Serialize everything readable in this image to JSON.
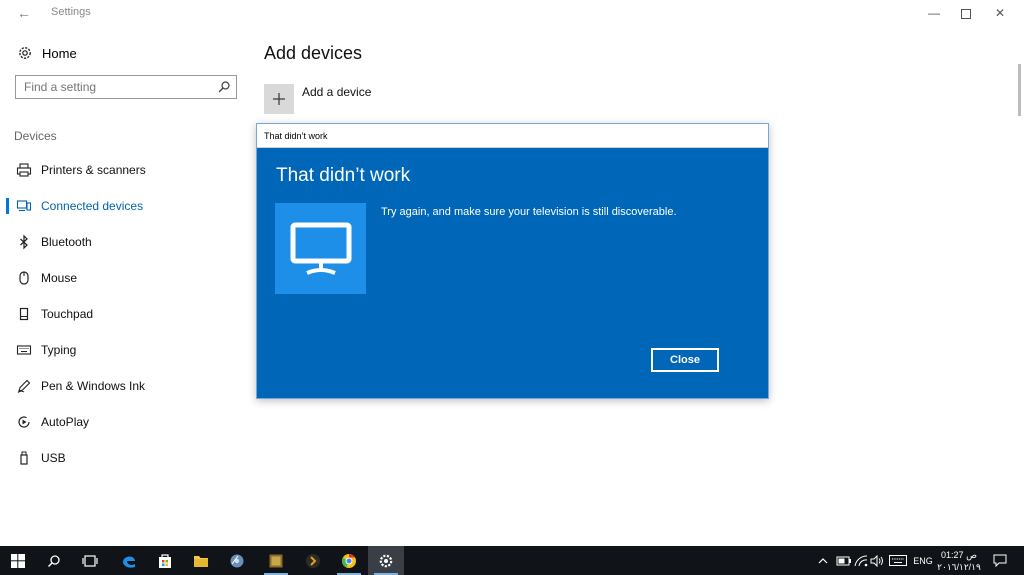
{
  "window": {
    "title": "Settings",
    "back_glyph": "←",
    "minimize_glyph": "—",
    "close_glyph": "✕"
  },
  "sidebar": {
    "home_label": "Home",
    "search_placeholder": "Find a setting",
    "section_label": "Devices",
    "items": [
      {
        "label": "Printers & scanners",
        "icon": "printer-icon"
      },
      {
        "label": "Connected devices",
        "icon": "connected-devices-icon",
        "active": true
      },
      {
        "label": "Bluetooth",
        "icon": "bluetooth-icon"
      },
      {
        "label": "Mouse",
        "icon": "mouse-icon"
      },
      {
        "label": "Touchpad",
        "icon": "touchpad-icon"
      },
      {
        "label": "Typing",
        "icon": "keyboard-icon"
      },
      {
        "label": "Pen & Windows Ink",
        "icon": "pen-icon"
      },
      {
        "label": "AutoPlay",
        "icon": "autoplay-icon"
      },
      {
        "label": "USB",
        "icon": "usb-icon"
      }
    ]
  },
  "main": {
    "title": "Add devices",
    "add_device_label": "Add a device"
  },
  "dialog": {
    "window_title": "That didn’t work",
    "heading": "That didn’t work",
    "message": "Try again, and make sure your television is still discoverable.",
    "close_label": "Close",
    "icon": "monitor-icon"
  },
  "taskbar": {
    "apps": [
      "start",
      "search",
      "task-view",
      "edge",
      "store",
      "file-explorer",
      "media-player",
      "app",
      "plex",
      "chrome",
      "settings"
    ],
    "tray": {
      "language": "ENG",
      "time": "01:27 ص",
      "date": "٢٠١٦/١٢/١٩"
    }
  },
  "colors": {
    "accent": "#0078d7",
    "dialog_bg": "#0067b8",
    "dialog_tile": "#1d8fe8",
    "taskbar": "#101418"
  }
}
